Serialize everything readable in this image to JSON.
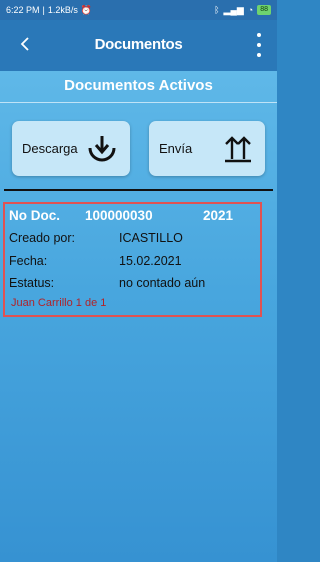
{
  "status_bar": {
    "time": "6:22 PM",
    "speed": "1.2kB/s",
    "battery": "88"
  },
  "app_bar": {
    "title": "Documentos",
    "back_icon": "back-arrow-icon",
    "menu_icon": "kebab-menu-icon"
  },
  "section": {
    "title": "Documentos Activos"
  },
  "actions": {
    "download_label": "Descarga",
    "download_icon": "download-icon",
    "send_label": "Envía",
    "send_icon": "upload-arrows-icon"
  },
  "document": {
    "no_doc_label": "No Doc.",
    "no_doc_value": "100000030",
    "year": "2021",
    "created_by_label": "Creado por:",
    "created_by_value": "ICASTILLO",
    "date_label": "Fecha:",
    "date_value": "15.02.2021",
    "status_label": "Estatus:",
    "status_value": "no contado aún",
    "owner_text": "Juan Carrillo 1 de 1"
  },
  "colors": {
    "app_bar": "#2a78b8",
    "card_border": "#e05252",
    "button_bg": "#c6e7f8",
    "owner_text": "#b0242a"
  }
}
